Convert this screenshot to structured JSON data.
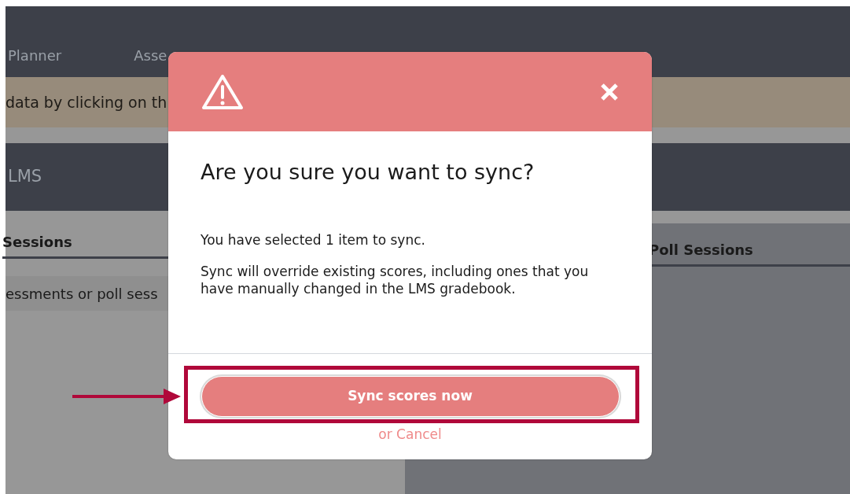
{
  "nav": {
    "tabs": [
      {
        "label": "Planner"
      },
      {
        "label": "Asse"
      }
    ]
  },
  "banner": {
    "text": "data by clicking on th"
  },
  "section": {
    "title": "LMS"
  },
  "left_panel": {
    "heading": "Sessions",
    "row": "essments or poll sess"
  },
  "right_panel": {
    "heading": "Poll Sessions"
  },
  "dialog": {
    "title": "Are you sure you want to sync?",
    "paragraphs": [
      "You have selected 1 item to sync.",
      "Sync will override existing scores, including ones that you have manually changed in the LMS gradebook."
    ],
    "primary_button": "Sync scores now",
    "cancel_link": "or Cancel"
  },
  "annotation": {
    "highlight": true
  }
}
